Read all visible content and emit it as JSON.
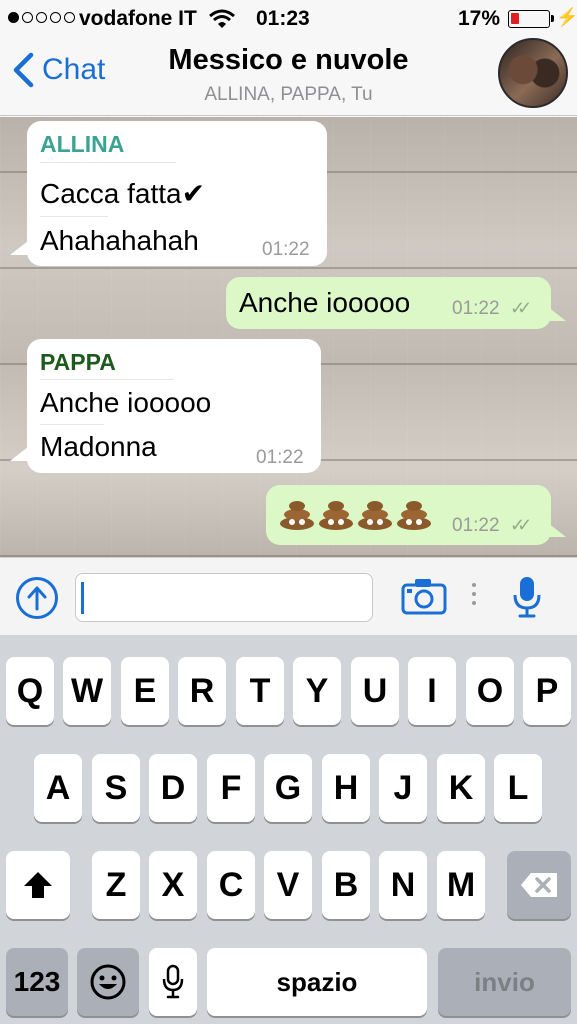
{
  "status_bar": {
    "carrier": "vodafone IT",
    "time": "01:23",
    "battery_percent": "17%",
    "signal_bars_filled": 1,
    "signal_bars_total": 5
  },
  "nav": {
    "back_label": "Chat",
    "title": "Messico e nuvole",
    "subtitle": "ALLINA, PAPPA, Tu"
  },
  "messages": [
    {
      "sender": "ALLINA",
      "sender_color": "#3aa394",
      "lines": [
        "Cacca fatta✔",
        "Ahahahahah"
      ],
      "time": "01:22",
      "direction": "in"
    },
    {
      "lines": [
        "Anche iooooo"
      ],
      "time": "01:22",
      "direction": "out",
      "ticks": "✓✓"
    },
    {
      "sender": "PAPPA",
      "sender_color": "#1e5a1e",
      "lines": [
        "Anche iooooo",
        "Madonna"
      ],
      "time": "01:22",
      "direction": "in"
    },
    {
      "emoji_count": 4,
      "emoji_name": "pile-of-poo",
      "time": "01:22",
      "direction": "out",
      "ticks": "✓✓"
    }
  ],
  "input": {
    "value": "",
    "placeholder": ""
  },
  "keyboard": {
    "row1": [
      "Q",
      "W",
      "E",
      "R",
      "T",
      "Y",
      "U",
      "I",
      "O",
      "P"
    ],
    "row2": [
      "A",
      "S",
      "D",
      "F",
      "G",
      "H",
      "J",
      "K",
      "L"
    ],
    "row3": [
      "Z",
      "X",
      "C",
      "V",
      "B",
      "N",
      "M"
    ],
    "numbers_label": "123",
    "space_label": "spazio",
    "send_label": "invio"
  },
  "colors": {
    "accent": "#1a6fd6",
    "outgoing_bubble": "#dcf8c6",
    "incoming_bubble": "#ffffff"
  }
}
